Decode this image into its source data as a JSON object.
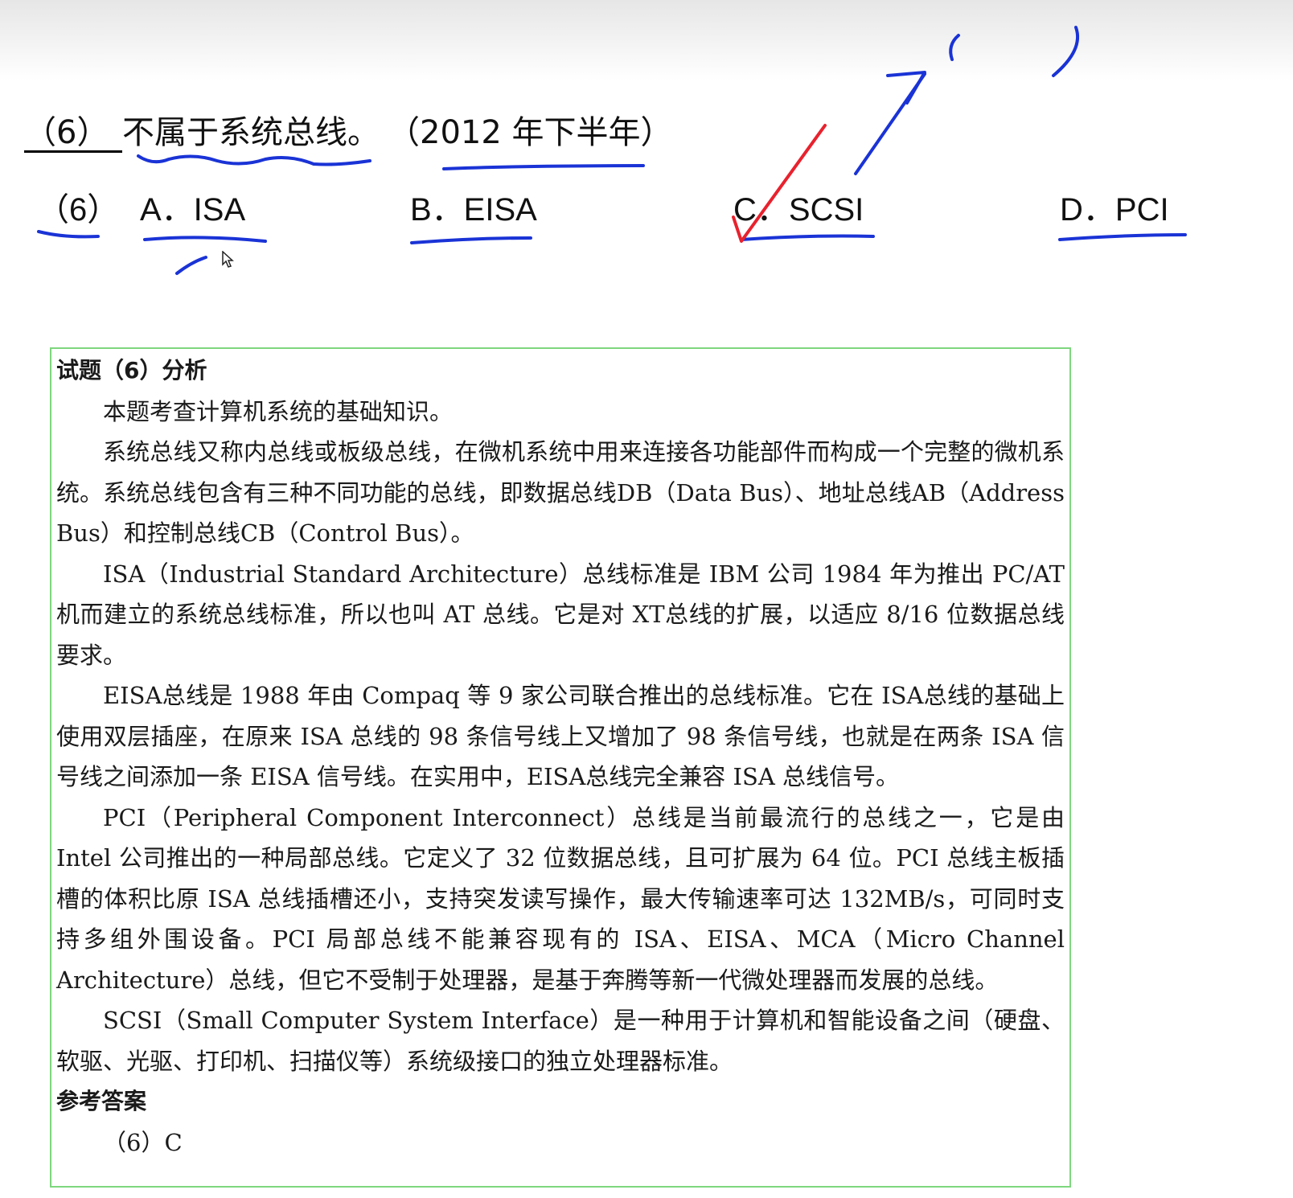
{
  "question": {
    "number": "（6）",
    "text": "不属于系统总线。",
    "year": "（2012 年下半年）"
  },
  "options": {
    "number": "（6）",
    "a": "A．ISA",
    "b": "B．EISA",
    "c": "C．SCSI",
    "d": "D．PCI"
  },
  "annotations": {
    "blank_marks": "(      )",
    "check_color": "#e8222e",
    "pen_color": "#1a33d6"
  },
  "analysis": {
    "heading": "试题（6）分析",
    "paragraphs": [
      "本题考查计算机系统的基础知识。",
      "系统总线又称内总线或板级总线，在微机系统中用来连接各功能部件而构成一个完整的微机系统。系统总线包含有三种不同功能的总线，即数据总线DB（Data Bus）、地址总线AB（Address Bus）和控制总线CB（Control Bus）。",
      "ISA（Industrial Standard Architecture）总线标准是 IBM 公司 1984 年为推出 PC/AT 机而建立的系统总线标准，所以也叫 AT 总线。它是对 XT总线的扩展，以适应 8/16 位数据总线要求。",
      "EISA总线是 1988 年由 Compaq 等 9 家公司联合推出的总线标准。它在 ISA总线的基础上使用双层插座，在原来 ISA 总线的 98 条信号线上又增加了 98 条信号线，也就是在两条 ISA 信号线之间添加一条 EISA 信号线。在实用中，EISA总线完全兼容 ISA 总线信号。",
      "PCI（Peripheral Component Interconnect）总线是当前最流行的总线之一，它是由 Intel 公司推出的一种局部总线。它定义了 32 位数据总线，且可扩展为 64 位。PCI 总线主板插槽的体积比原 ISA 总线插槽还小，支持突发读写操作，最大传输速率可达 132MB/s，可同时支持多组外围设备。PCI 局部总线不能兼容现有的 ISA、EISA、MCA（Micro Channel Architecture）总线，但它不受制于处理器，是基于奔腾等新一代微处理器而发展的总线。",
      "SCSI（Small Computer System Interface）是一种用于计算机和智能设备之间（硬盘、软驱、光驱、打印机、扫描仪等）系统级接口的独立处理器标准。"
    ],
    "answer_heading": "参考答案",
    "answer": "（6）C"
  }
}
